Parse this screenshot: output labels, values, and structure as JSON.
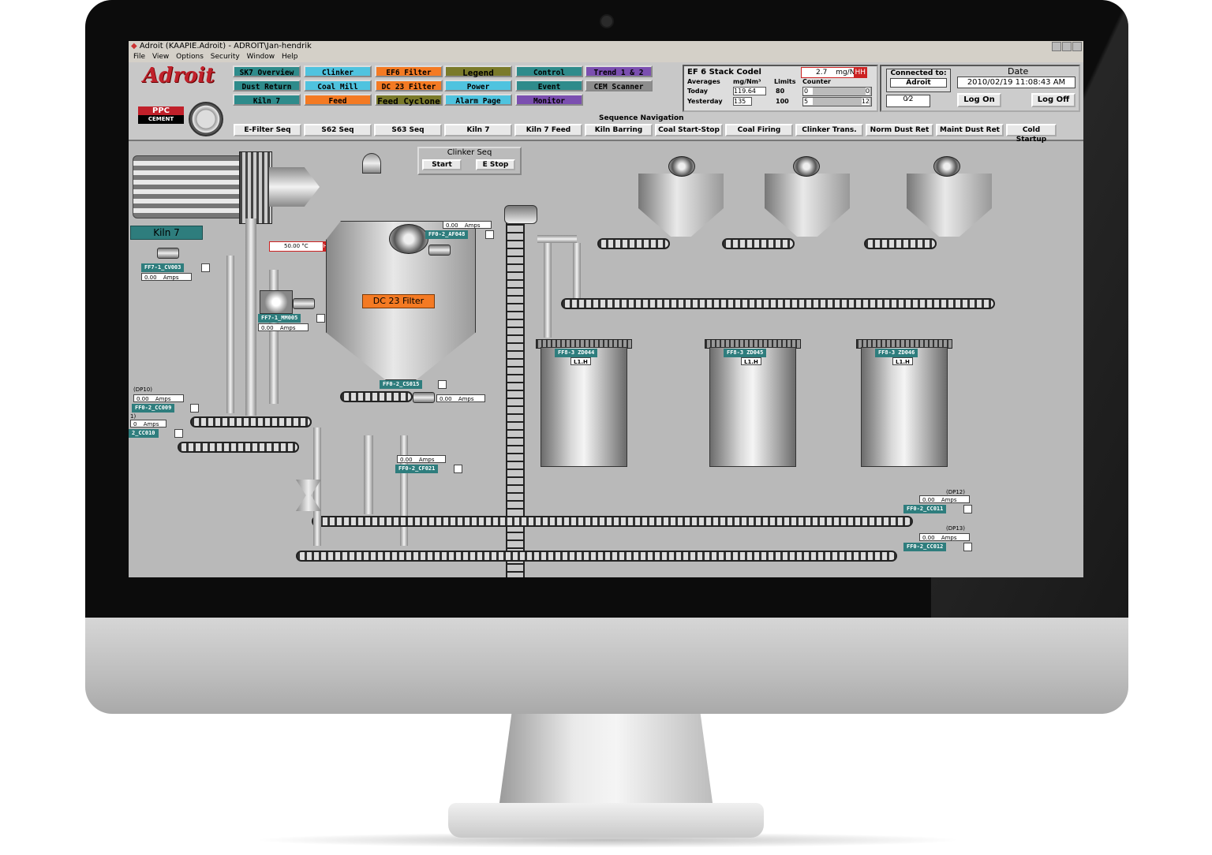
{
  "window": {
    "title": "Adroit (KAAPIE.Adroit) - ADROIT\\Jan-hendrik"
  },
  "menu": [
    "File",
    "View",
    "Options",
    "Security",
    "Window",
    "Help"
  ],
  "brand": {
    "logo": "Adroit",
    "ppc": "PPC",
    "cement": "CEMENT"
  },
  "nav_buttons": [
    {
      "label": "SK7 Overview",
      "color": "teal"
    },
    {
      "label": "Clinker",
      "color": "cyan"
    },
    {
      "label": "EF6 Filter",
      "color": "orange"
    },
    {
      "label": "Legend",
      "color": "olive"
    },
    {
      "label": "Control",
      "color": "teal"
    },
    {
      "label": "Trend 1 & 2",
      "color": "purple"
    },
    {
      "label": "Dust Return",
      "color": "teal"
    },
    {
      "label": "Coal Mill",
      "color": "cyan"
    },
    {
      "label": "DC 23 Filter",
      "color": "orange"
    },
    {
      "label": "Power",
      "color": "cyan"
    },
    {
      "label": "Event",
      "color": "teal"
    },
    {
      "label": "CEM Scanner",
      "color": "grey"
    },
    {
      "label": "Kiln 7",
      "color": "teal"
    },
    {
      "label": "Feed",
      "color": "orange"
    },
    {
      "label": "Feed Cyclone",
      "color": "olive"
    },
    {
      "label": "Alarm Page",
      "color": "cyan"
    },
    {
      "label": "Monitor",
      "color": "purple"
    }
  ],
  "stack": {
    "title": "EF 6 Stack Codel",
    "reading": "2.7",
    "unit": "mg/N",
    "alarm": "HH",
    "col_averages": "Averages",
    "col_mg": "mg/Nm³",
    "col_limits": "Limits",
    "col_counter": "Counter",
    "today_label": "Today",
    "today_value": "119.64",
    "today_limit": "80",
    "today_c1": "0",
    "today_c2": "0",
    "yesterday_label": "Yesterday",
    "yesterday_value": "135",
    "yesterday_limit": "100",
    "yesterday_c1": "5",
    "yesterday_c2": "12"
  },
  "connection": {
    "label": "Connected to:",
    "server": "Adroit",
    "fraction": "0⁄2"
  },
  "date": {
    "label": "Date",
    "value": "2010/02/19 11:08:43 AM",
    "logon": "Log On",
    "logoff": "Log Off"
  },
  "sequence_nav": {
    "title": "Sequence Navigation",
    "items": [
      "E-Filter Seq",
      "S62 Seq",
      "S63 Seq",
      "Kiln 7",
      "Kiln 7 Feed",
      "Kiln Barring",
      "Coal Start-Stop",
      "Coal Firing",
      "Clinker Trans.",
      "Norm Dust Ret",
      "Maint Dust Ret",
      "Cold Startup"
    ]
  },
  "clinker_seq": {
    "title": "Clinker Seq",
    "start": "Start",
    "estop": "E Stop"
  },
  "kiln_label": "Kiln 7",
  "temp": {
    "value": "50.00",
    "unit": "°C",
    "alarm": "HH"
  },
  "dc23_label": "DC 23 Filter",
  "tags": {
    "ff7_cv003": "FF7-1_CV003",
    "ff7_mm005": "FF7-1_MM005",
    "ff0_af048": "FF0-2_AF048",
    "ff0_cs015": "FF0-2_CS015",
    "ff0_cf021": "FF0-2_CF021",
    "ff0_cc009": "FF0-2_CC009",
    "ff0_cc010": "2_CC010",
    "ff0_cc011": "FF0-2_CC011",
    "ff0_cc012": "FF0-2_CC012",
    "zd044": "FF8-3 ZD044",
    "zd045": "FF8-3 ZD045",
    "zd046": "FF8-3 ZD046",
    "lih": "L1.H",
    "dp10": "(DP10)",
    "dp11": "1)",
    "dp12": "(DP12)",
    "dp13": "(DP13)"
  },
  "amps": {
    "value": "0.00",
    "unit": "Amps",
    "short_value": "0"
  }
}
